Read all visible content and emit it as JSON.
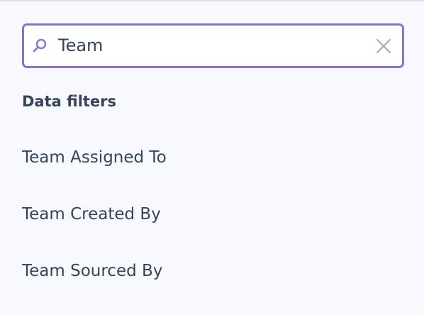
{
  "search": {
    "value": "Team",
    "icon": "search-icon",
    "clear_icon": "close-icon"
  },
  "section": {
    "heading": "Data filters"
  },
  "filters": [
    {
      "label": "Team Assigned To"
    },
    {
      "label": "Team Created By"
    },
    {
      "label": "Team Sourced By"
    }
  ],
  "colors": {
    "accent": "#8b6ee0",
    "text": "#34445a",
    "background": "#f7f9fe",
    "clear_icon": "#a4adb9"
  }
}
